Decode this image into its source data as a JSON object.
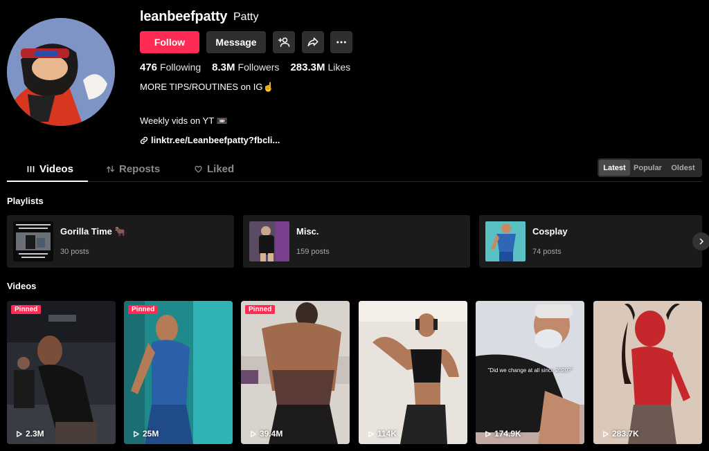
{
  "profile": {
    "username": "leanbeefpatty",
    "nickname": "Patty",
    "follow_label": "Follow",
    "message_label": "Message",
    "stats": {
      "following_count": "476",
      "following_label": "Following",
      "followers_count": "8.3M",
      "followers_label": "Followers",
      "likes_count": "283.3M",
      "likes_label": "Likes"
    },
    "bio_line_1": "MORE TIPS/ROUTINES on IG☝️",
    "bio_line_2": "Weekly vids on YT 📼",
    "link": "linktr.ee/Leanbeefpatty?fbcli..."
  },
  "tabs": {
    "videos": "Videos",
    "reposts": "Reposts",
    "liked": "Liked"
  },
  "sort": {
    "latest": "Latest",
    "popular": "Popular",
    "oldest": "Oldest",
    "active": "Latest"
  },
  "playlists": {
    "heading": "Playlists",
    "items": [
      {
        "name": "Gorilla Time 🐂",
        "count": "30 posts"
      },
      {
        "name": "Misc.",
        "count": "159 posts"
      },
      {
        "name": "Cosplay",
        "count": "74 posts"
      }
    ]
  },
  "videos": {
    "heading": "Videos",
    "pinned_label": "Pinned",
    "items": [
      {
        "views": "2.3M",
        "pinned": true
      },
      {
        "views": "25M",
        "pinned": true
      },
      {
        "views": "39.4M",
        "pinned": true
      },
      {
        "views": "114K",
        "pinned": false
      },
      {
        "views": "174.9K",
        "pinned": false,
        "caption": "\"Did we change at all since 2020?\""
      },
      {
        "views": "283.7K",
        "pinned": false
      }
    ]
  },
  "colors": {
    "accent": "#fe2c55",
    "background": "#000000",
    "button_secondary": "#2f2f2f"
  }
}
